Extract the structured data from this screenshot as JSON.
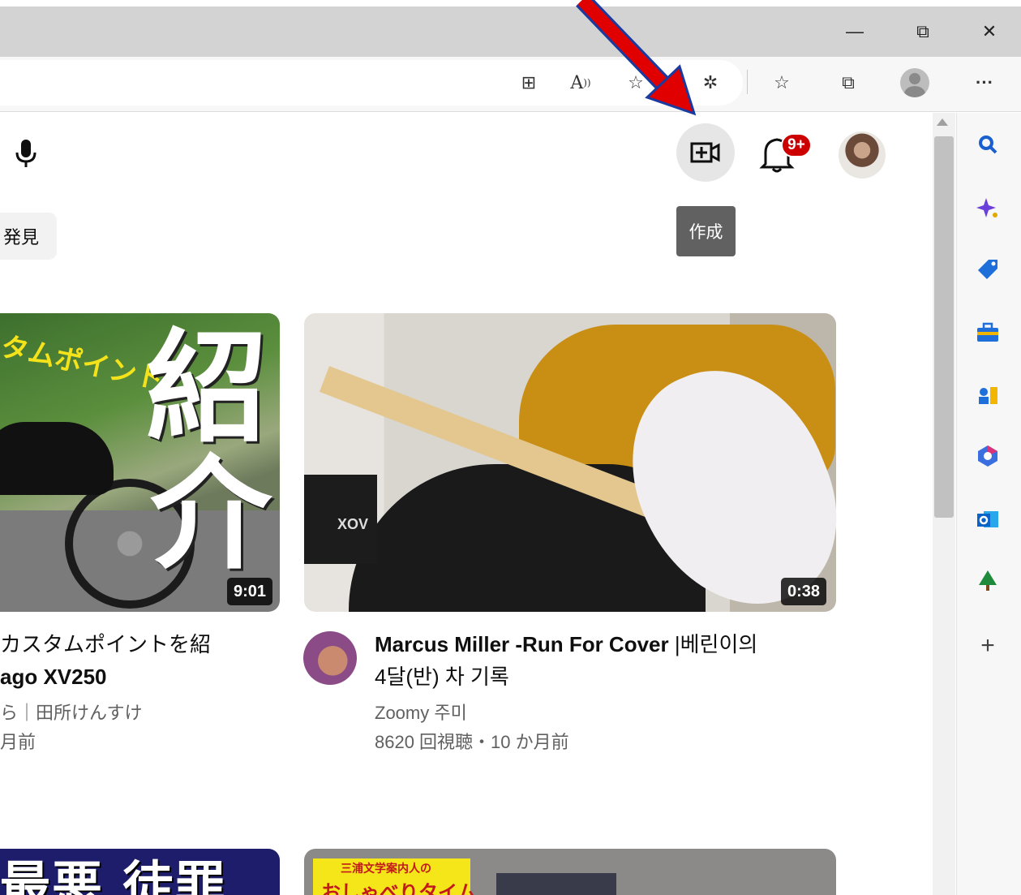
{
  "window": {
    "minimize_glyph": "—",
    "restore_glyph": "⧉",
    "close_glyph": "✕"
  },
  "toolbar_icons": [
    "split-screen-icon",
    "read-aloud-icon",
    "add-favorite-icon",
    "extensions-icon",
    "favorites-icon",
    "collections-icon",
    "profile-icon",
    "more-icon"
  ],
  "toolbar": {
    "split_glyph": "⊞",
    "read_aloud_glyph": "A",
    "favorite_glyph": "☆",
    "extensions_glyph": "✲",
    "favorites_glyph": "☆",
    "collections_glyph": "⧉",
    "more_glyph": "···"
  },
  "youtube": {
    "chip_label": "発見",
    "tooltip": "作成",
    "notification_badge": "9+"
  },
  "videos": [
    {
      "title_line1": "カスタムポイントを紹",
      "title_line2": "ago XV250",
      "channel": "ら｜田所けんすけ",
      "meta": "月前",
      "duration": "9:01",
      "thumb_text_big1": "紹",
      "thumb_text_big2": "介",
      "thumb_text_yellow": "タムポイント"
    },
    {
      "title_line1_a": "Marcus Miller -Run For Cover",
      "title_line1_b": " |베린이의",
      "title_line2": "4달(반) 차 기록",
      "channel": "Zoomy 주미",
      "meta": "8620 回視聴・10 か月前",
      "duration": "0:38",
      "amp_label": "XOV"
    }
  ],
  "bottom_row": {
    "thumb3_text": "最悪 徒罪",
    "sticker_line1": "三浦文学案内人の",
    "sticker_line2": "おしゃべりタイム"
  },
  "sidebar_icons": [
    "search-icon",
    "copilot-icon",
    "shopping-icon",
    "tools-icon",
    "games-icon",
    "microsoft365-icon",
    "outlook-icon",
    "tree-icon",
    "add-icon"
  ],
  "sidebar": {
    "add_glyph": "+"
  },
  "colors": {
    "titlebar": "#d3d3d3",
    "badge": "#cc0000",
    "arrow": "#e00000"
  }
}
